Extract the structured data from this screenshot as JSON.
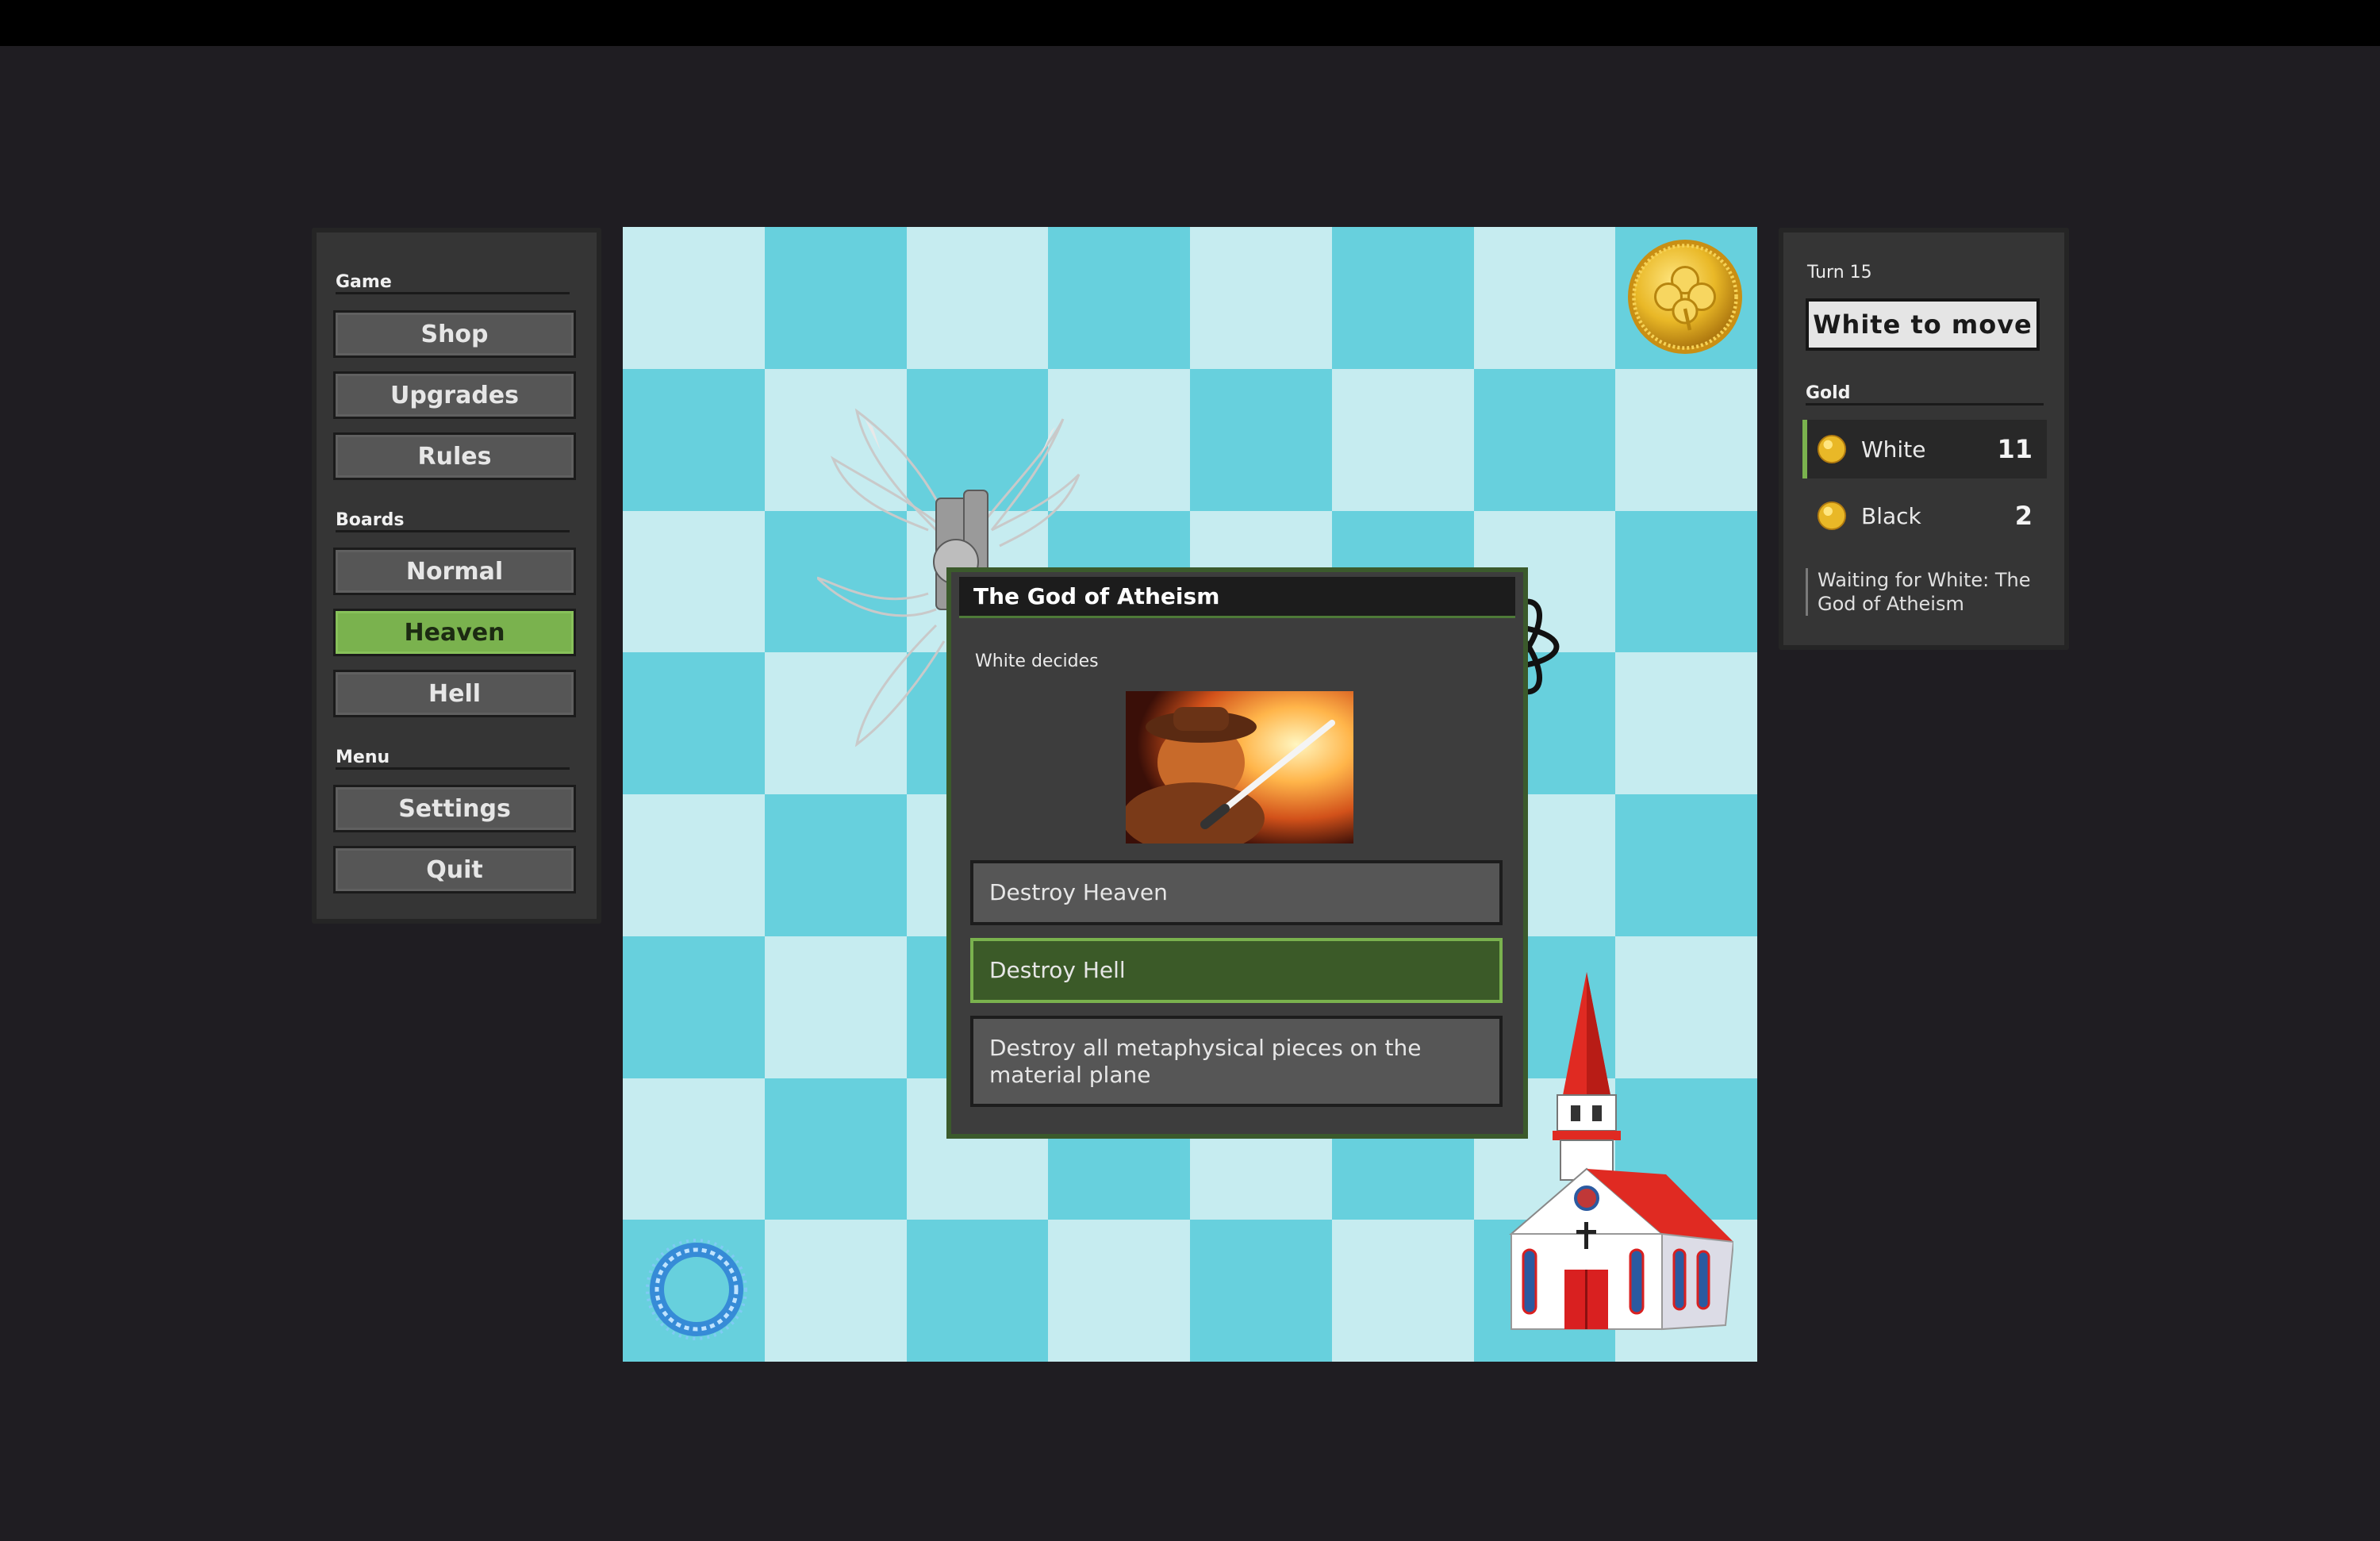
{
  "sidebar": {
    "game_section": "Game",
    "game_buttons": [
      "Shop",
      "Upgrades",
      "Rules"
    ],
    "boards_section": "Boards",
    "board_buttons": [
      "Normal",
      "Heaven",
      "Hell"
    ],
    "active_board": "Heaven",
    "menu_section": "Menu",
    "menu_buttons": [
      "Settings",
      "Quit"
    ]
  },
  "board": {
    "size": 8,
    "light_color": "#c6ecf0",
    "dark_color": "#67d0dd",
    "pieces": [
      "gold-coin",
      "winged-angel",
      "atom",
      "blue-portal-ring",
      "church"
    ]
  },
  "modal": {
    "title": "The God of Atheism",
    "subtitle": "White decides",
    "choices": [
      "Destroy Heaven",
      "Destroy Hell",
      "Destroy all metaphysical pieces on the material plane"
    ],
    "highlighted_choice": "Destroy Hell"
  },
  "status": {
    "turn": "Turn 15",
    "to_move": "White to move",
    "gold_title": "Gold",
    "players": [
      {
        "name": "White",
        "gold": "11"
      },
      {
        "name": "Black",
        "gold": "2"
      }
    ],
    "waiting": "Waiting for White: The God of Atheism"
  },
  "colors": {
    "accent_green": "#7ab24e",
    "panel": "#353535",
    "background": "#1f1d22"
  }
}
